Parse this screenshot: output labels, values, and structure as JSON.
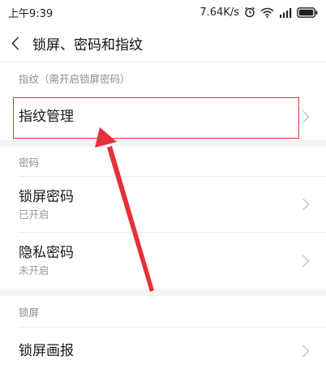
{
  "status_bar": {
    "time": "上午9:39",
    "network_speed": "7.64K/s",
    "icons": [
      "alarm-icon",
      "wifi-icon",
      "signal-icon",
      "battery-icon"
    ]
  },
  "nav": {
    "back_icon": "chevron-left-icon",
    "title": "锁屏、密码和指纹"
  },
  "sections": [
    {
      "header": "指纹（需开启锁屏密码）",
      "items": [
        {
          "title": "指纹管理",
          "subtitle": ""
        }
      ]
    },
    {
      "header": "密码",
      "items": [
        {
          "title": "锁屏密码",
          "subtitle": "已开启"
        },
        {
          "title": "隐私密码",
          "subtitle": "未开启"
        }
      ]
    },
    {
      "header": "锁屏",
      "items": [
        {
          "title": "锁屏画报",
          "subtitle": ""
        }
      ]
    }
  ],
  "annotation": {
    "highlight_color": "#e5313a",
    "target": "指纹管理"
  }
}
